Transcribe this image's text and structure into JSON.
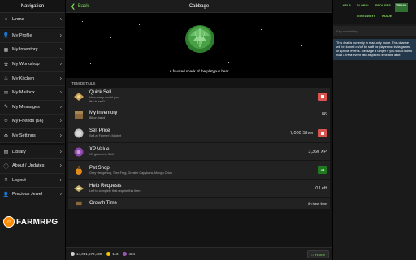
{
  "nav": {
    "title": "Navigation",
    "items": [
      {
        "label": "Home",
        "icon": "home-icon"
      },
      {
        "label": "My Profile",
        "icon": "user-icon"
      },
      {
        "label": "My Inventory",
        "icon": "inventory-icon"
      },
      {
        "label": "My Workshop",
        "icon": "workshop-icon"
      },
      {
        "label": "My Kitchen",
        "icon": "kitchen-icon"
      },
      {
        "label": "My Mailbox",
        "icon": "mailbox-icon"
      },
      {
        "label": "My Messages",
        "icon": "messages-icon"
      },
      {
        "label": "My Friends (66)",
        "icon": "friends-icon"
      },
      {
        "label": "My Settings",
        "icon": "settings-icon"
      },
      {
        "label": "Library",
        "icon": "library-icon"
      },
      {
        "label": "About / Updates",
        "icon": "info-icon"
      },
      {
        "label": "Logout",
        "icon": "close-icon"
      },
      {
        "label": "Precious Jewel",
        "icon": "user-icon"
      }
    ],
    "logo_text": "FARMRPG"
  },
  "header": {
    "back_label": "Back",
    "title": "Cabbage"
  },
  "hero": {
    "caption": "A favored snack of the platypus bear"
  },
  "details": {
    "section_label": "ITEM DETAILS",
    "rows": [
      {
        "name": "Quick Sell",
        "sub": "How many would you",
        "sub2": "like to sell?",
        "value": "",
        "action": "red",
        "icon": "quick-sell-icon"
      },
      {
        "name": "My Inventory",
        "sub": "86 on-hand",
        "value": "86",
        "action": "none",
        "icon": "inventory-box-icon"
      },
      {
        "name": "Sell Price",
        "sub": "Sell at Farmer's Market",
        "value": "7,000 Silver",
        "action": "red",
        "icon": "silver-coin-icon"
      },
      {
        "name": "XP Value",
        "sub": "XP gained to Skill",
        "value": "3,360 XP",
        "action": "none",
        "icon": "xp-icon"
      },
      {
        "name": "Pet Shop",
        "sub": "Grey Hedgehog, Tree Frog, Greater Capybara, Mango Orion",
        "value": "",
        "action": "green",
        "icon": "pet-shop-icon"
      },
      {
        "name": "Help Requests",
        "sub": "Left to complete that require this item",
        "value": "0 Left",
        "action": "none",
        "icon": "help-requests-icon"
      },
      {
        "name": "Growth Time",
        "sub": "",
        "value": "8h base time",
        "action": "none",
        "icon": "growth-time-icon"
      }
    ]
  },
  "footer": {
    "silver": "14,031,570,439",
    "gold": "113",
    "other": "484",
    "home_label": "Home"
  },
  "chat": {
    "tabs": [
      "HELP",
      "GLOBAL",
      "SPOILERS",
      "TRIVIA",
      "GIVEAWAYS",
      "TRADE"
    ],
    "active_tab": "TRIVIA",
    "input_placeholder": "Say something...",
    "message": "This chat is currently in read-only mode. This channel will be turned on/off by staff for player run trivia games or special events. Message a ranger if you would like to host a trivia event with a specific time and date."
  },
  "colors": {
    "accent": "#7ed957",
    "danger": "#d9534f",
    "success": "#1f7a1f",
    "chat_msg_bg": "#23384a"
  }
}
